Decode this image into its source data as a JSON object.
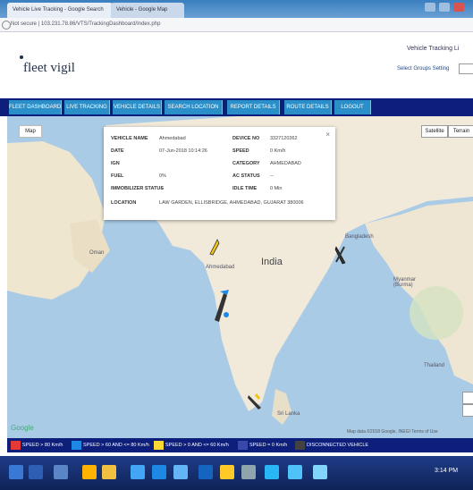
{
  "browser": {
    "tabs": [
      {
        "label": "Vehicle Live Tracking - Google Search"
      },
      {
        "label": "Vehicle - Google Map"
      }
    ],
    "address": "Not secure | 103.231.78.86/VTS/TrackingDashboard/Index.php"
  },
  "header": {
    "logo": "fleet vigil",
    "tracking_label": "Vehicle Tracking Li",
    "groups_label": "Select Groups Setting"
  },
  "nav": {
    "items": [
      {
        "label": "FLEET DASHBOARD"
      },
      {
        "label": "LIVE TRACKING"
      },
      {
        "label": "VEHICLE DETAILS"
      },
      {
        "label": "SEARCH LOCATION"
      },
      {
        "label": "REPORT DETAILS"
      },
      {
        "label": "ROUTE DETAILS"
      },
      {
        "label": "LOGOUT"
      }
    ]
  },
  "map": {
    "type_button": "Map",
    "btn_satellite": "Satellite",
    "btn_terrain": "Terrain",
    "country_label": "India",
    "labels": {
      "bangladesh": "Bangladesh",
      "myanmar": "Myanmar (Burma)",
      "thailand": "Thailand",
      "sri_lanka": "Sri Lanka",
      "oman": "Oman",
      "ahmedabad": "Ahmedabad"
    },
    "google": "Google",
    "footer": "Map data ©2018 Google, INEGI  Terms of Use"
  },
  "popup": {
    "rows": [
      {
        "k1": "VEHICLE NAME",
        "v1": "Ahmedabad",
        "k2": "DEVICE NO",
        "v2": "3327120362"
      },
      {
        "k1": "DATE",
        "v1": "07-Jun-2018 10:14:26",
        "k2": "SPEED",
        "v2": "0 Km/h"
      },
      {
        "k1": "IGN",
        "v1": "",
        "k2": "CATEGORY",
        "v2": "AHMEDABAD"
      },
      {
        "k1": "FUEL",
        "v1": "0%",
        "k2": "AC STATUS",
        "v2": "--"
      },
      {
        "k1": "IMMOBILIZER STATUS",
        "v1": "--",
        "k2": "IDLE TIME",
        "v2": "0 Min"
      },
      {
        "k1": "LOCATION",
        "v1": "LAW GARDEN, ELLISBRIDGE, AHMEDABAD, GUJARAT 380006",
        "k2": "",
        "v2": ""
      }
    ],
    "close": "×"
  },
  "legend": {
    "items": [
      {
        "label": "SPEED > 80 Km/h",
        "color": "#e53935"
      },
      {
        "label": "SPEED > 60 AND <= 80 Km/h",
        "color": "#1e88e5"
      },
      {
        "label": "SPEED > 0 AND <= 60 Km/h",
        "color": "#fdd835"
      },
      {
        "label": "SPEED = 0 Km/h",
        "color": "#3949ab"
      },
      {
        "label": "DISCONNECTED VEHICLE",
        "color": "#424242"
      }
    ]
  },
  "taskbar": {
    "icons": [
      "start-icon",
      "explorer-icon",
      "media-icon",
      "edge-icon",
      "folder-icon",
      "ie-icon",
      "chrome-icon",
      "store-icon",
      "photos-icon",
      "mail-icon",
      "word-icon",
      "network-icon",
      "skype-icon",
      "photos2-icon"
    ],
    "clock": "3:14 PM"
  }
}
